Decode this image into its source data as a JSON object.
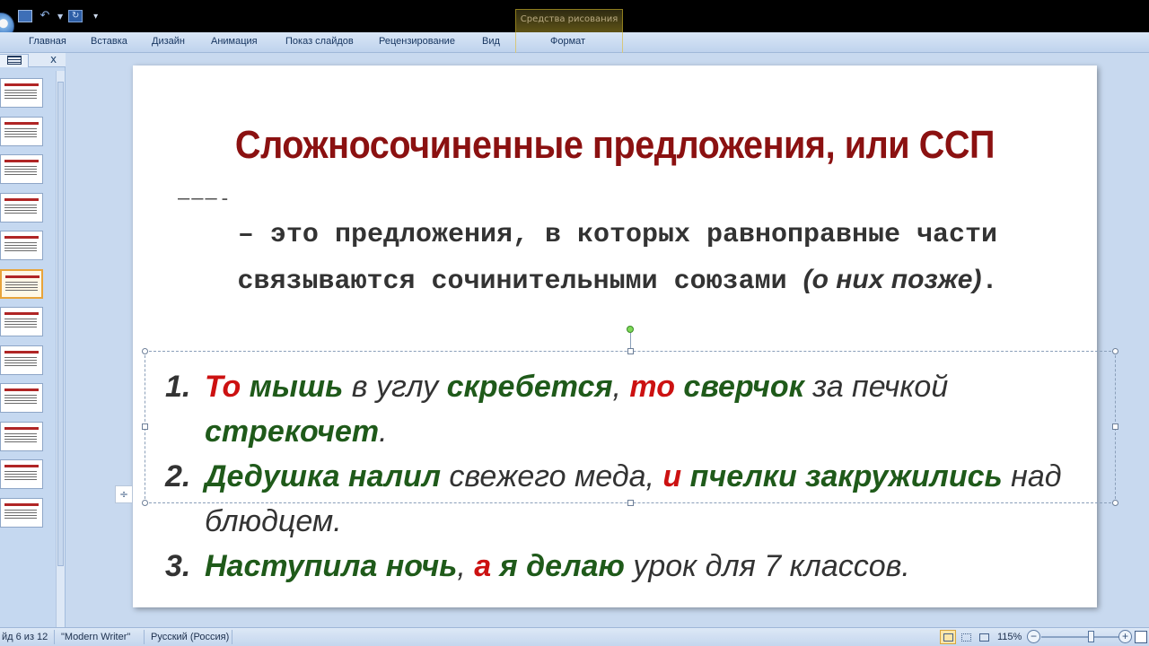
{
  "quick_access": {
    "icons": [
      "office-button",
      "save-icon",
      "undo-icon",
      "redo-icon",
      "customize-toolbar-icon"
    ]
  },
  "contextual_group": "Средства рисования",
  "ribbon_tabs": [
    {
      "label": "Главная"
    },
    {
      "label": "Вставка"
    },
    {
      "label": "Дизайн"
    },
    {
      "label": "Анимация"
    },
    {
      "label": "Показ слайдов"
    },
    {
      "label": "Рецензирование"
    },
    {
      "label": "Вид"
    },
    {
      "label": "Формат"
    }
  ],
  "left_panel": {
    "close_symbol": "x",
    "thumbnail_count": 12,
    "selected_index": 5
  },
  "slide": {
    "title": "Сложносочиненные предложения, или ССП",
    "dashes": "–––-",
    "definition_main": "– это предложения, в которых равноправные части связываются сочинительными союзами",
    "definition_paren": "(о них позже)",
    "definition_end": ".",
    "examples": [
      {
        "num": "1.",
        "parts": [
          {
            "t": "То",
            "s": "r"
          },
          {
            "t": " ",
            "s": "n"
          },
          {
            "t": "мышь",
            "s": "g"
          },
          {
            "t": " в углу ",
            "s": "i"
          },
          {
            "t": "скребется",
            "s": "g"
          },
          {
            "t": ", ",
            "s": "i"
          },
          {
            "t": "то",
            "s": "r"
          },
          {
            "t": " ",
            "s": "n"
          },
          {
            "t": "сверчок",
            "s": "g"
          },
          {
            "t": " за печкой ",
            "s": "i"
          },
          {
            "t": "стрекочет",
            "s": "g"
          },
          {
            "t": ".",
            "s": "i"
          }
        ]
      },
      {
        "num": "2.",
        "parts": [
          {
            "t": "Дедушка налил",
            "s": "g"
          },
          {
            "t": " свежего меда, ",
            "s": "i"
          },
          {
            "t": "и",
            "s": "r"
          },
          {
            "t": " ",
            "s": "n"
          },
          {
            "t": "пчелки закружились",
            "s": "g"
          },
          {
            "t": " над блюдцем.",
            "s": "i"
          }
        ]
      },
      {
        "num": "3.",
        "parts": [
          {
            "t": "Наступила ночь",
            "s": "g"
          },
          {
            "t": ", ",
            "s": "i"
          },
          {
            "t": "а",
            "s": "r"
          },
          {
            "t": " ",
            "s": "n"
          },
          {
            "t": "я делаю",
            "s": "g"
          },
          {
            "t": " урок для 7 классов.",
            "s": "i"
          }
        ]
      }
    ]
  },
  "status": {
    "slide_info": "йд 6 из 12",
    "theme": "\"Modern Writer\"",
    "language": "Русский (Россия)",
    "zoom": "115%",
    "zoom_minus": "−",
    "zoom_plus": "+",
    "zoom_level_fraction": 0.56
  },
  "colors": {
    "title": "#8b1111",
    "green_emphasis": "#1f5a1a",
    "red_emphasis": "#cc1111",
    "workspace_bg": "#c8d9ef"
  }
}
